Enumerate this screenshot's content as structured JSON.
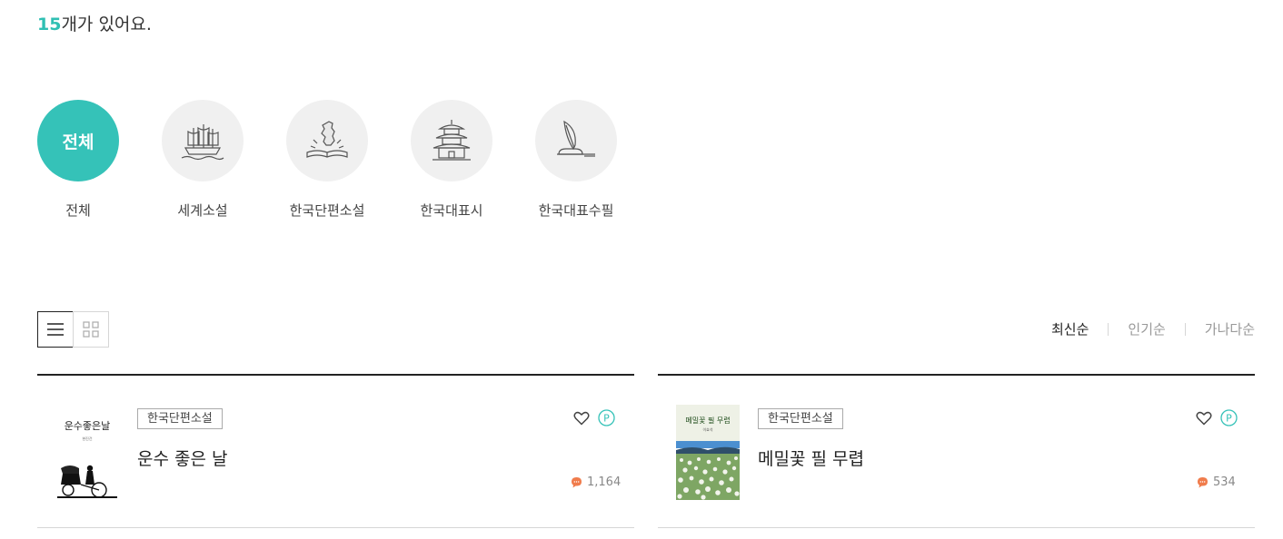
{
  "summary": {
    "count": "15",
    "suffix": "개가 있어요."
  },
  "categories": [
    {
      "label": "전체",
      "circle_text": "전체",
      "active": true,
      "icon": "all"
    },
    {
      "label": "세계소설",
      "icon": "sailing-ship-icon"
    },
    {
      "label": "한국단편소설",
      "icon": "korea-map-book-icon"
    },
    {
      "label": "한국대표시",
      "icon": "pagoda-icon"
    },
    {
      "label": "한국대표수필",
      "icon": "quill-inkpot-icon"
    }
  ],
  "view_modes": [
    "list",
    "grid"
  ],
  "sort": {
    "options": [
      "최신순",
      "인기순",
      "가나다순"
    ],
    "active": "최신순"
  },
  "items": [
    {
      "category": "한국단편소설",
      "title": "운수 좋은 날",
      "comments": "1,164",
      "cover_text": "운수좋은날",
      "cover_subtext": "현진건"
    },
    {
      "category": "한국단편소설",
      "title": "메밀꽃 필 무렵",
      "comments": "534",
      "cover_text": "메밀꽃 필 무렵",
      "cover_subtext": "이효석"
    }
  ],
  "colors": {
    "accent": "#35c2b8",
    "comment_icon": "#f07c4c",
    "text": "#222222",
    "muted": "#999999"
  }
}
